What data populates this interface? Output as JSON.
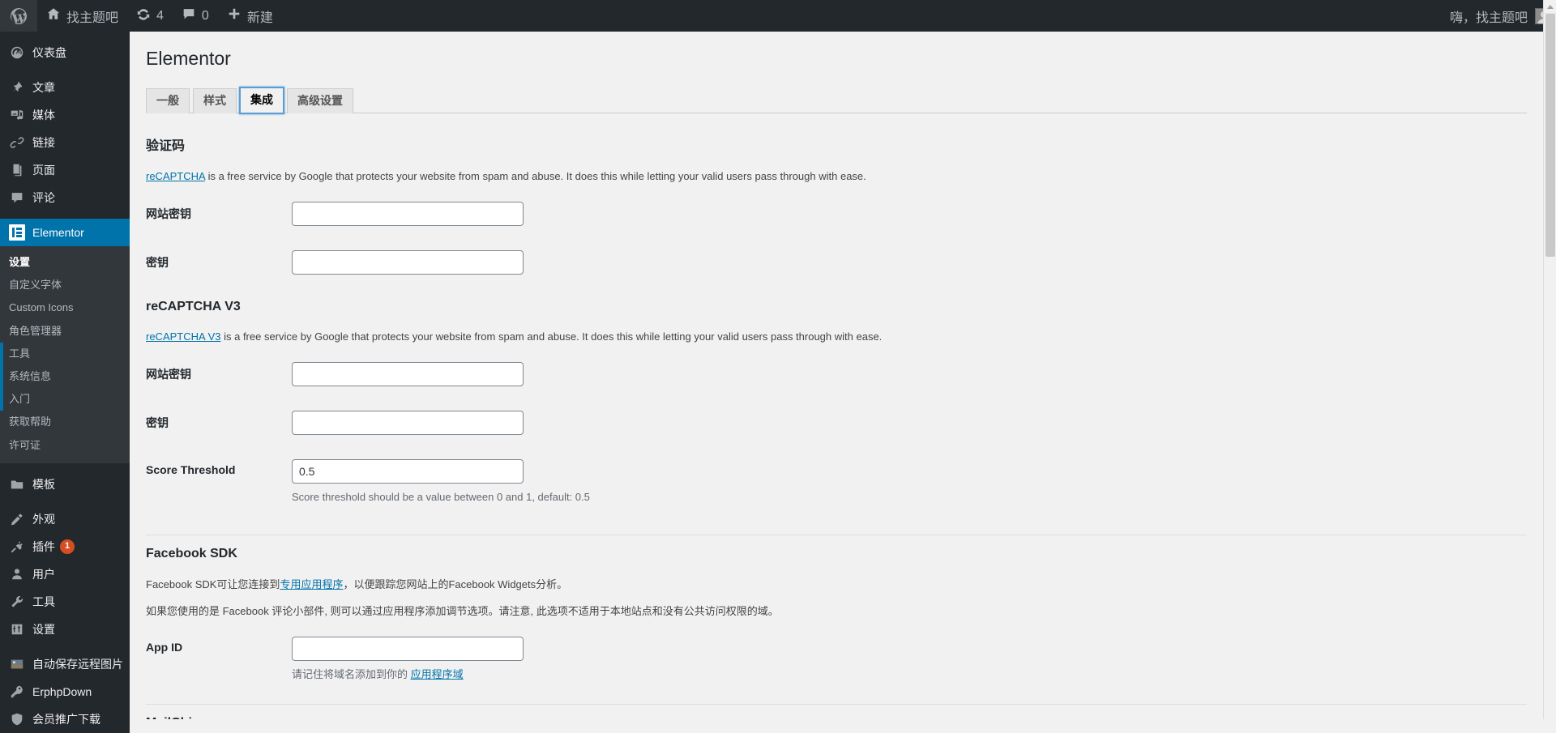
{
  "adminbar": {
    "logo_icon": "wordpress-logo-icon",
    "site_icon": "home-icon",
    "site_name": "找主题吧",
    "updates_icon": "updates-icon",
    "updates_count": "4",
    "comments_icon": "comment-bubble-icon",
    "comments_count": "0",
    "new_icon": "plus-icon",
    "new_label": "新建",
    "howdy": "嗨，找主题吧",
    "avatar": "user-avatar"
  },
  "sidebar": {
    "items": [
      {
        "label": "仪表盘",
        "icon": "dashboard-icon",
        "name": "dashboard"
      },
      {
        "label": "文章",
        "icon": "pin-icon",
        "name": "posts"
      },
      {
        "label": "媒体",
        "icon": "media-icon",
        "name": "media"
      },
      {
        "label": "链接",
        "icon": "link-icon",
        "name": "links"
      },
      {
        "label": "页面",
        "icon": "page-icon",
        "name": "pages"
      },
      {
        "label": "评论",
        "icon": "comment-icon",
        "name": "comments"
      },
      {
        "label": "Elementor",
        "icon": "elementor-icon",
        "name": "elementor",
        "current": true
      },
      {
        "label": "模板",
        "icon": "folder-icon",
        "name": "templates"
      },
      {
        "label": "外观",
        "icon": "appearance-icon",
        "name": "appearance"
      },
      {
        "label": "插件",
        "icon": "plugins-icon",
        "name": "plugins",
        "badge": "1"
      },
      {
        "label": "用户",
        "icon": "users-icon",
        "name": "users"
      },
      {
        "label": "工具",
        "icon": "tools-icon",
        "name": "tools"
      },
      {
        "label": "设置",
        "icon": "settings-icon",
        "name": "settings"
      },
      {
        "label": "自动保存远程图片",
        "icon": "image-icon",
        "name": "auto-save-remote-images"
      },
      {
        "label": "ErphpDown",
        "icon": "key-icon",
        "name": "erphpdown"
      },
      {
        "label": "会员推广下载",
        "icon": "shield-icon",
        "name": "member-promo-download"
      }
    ],
    "submenu": [
      {
        "label": "设置",
        "current": true
      },
      {
        "label": "自定义字体"
      },
      {
        "label": "Custom Icons"
      },
      {
        "label": "角色管理器"
      },
      {
        "label": "工具",
        "highlight": true
      },
      {
        "label": "系统信息",
        "highlight": true
      },
      {
        "label": "入门",
        "highlight": true
      },
      {
        "label": "获取帮助"
      },
      {
        "label": "许可证"
      }
    ]
  },
  "page": {
    "title": "Elementor",
    "tabs": [
      {
        "label": "一般",
        "active": false
      },
      {
        "label": "样式",
        "active": false
      },
      {
        "label": "集成",
        "active": true
      },
      {
        "label": "高级设置",
        "active": false
      }
    ]
  },
  "sections": {
    "recaptcha": {
      "title": "验证码",
      "desc_link": "reCAPTCHA",
      "desc_rest": " is a free service by Google that protects your website from spam and abuse. It does this while letting your valid users pass through with ease.",
      "fields": [
        {
          "label": "网站密钥",
          "value": "",
          "placeholder": "",
          "name": "recaptcha-site-key"
        },
        {
          "label": "密钥",
          "value": "",
          "placeholder": "",
          "name": "recaptcha-secret-key"
        }
      ]
    },
    "recaptcha_v3": {
      "title": "reCAPTCHA V3",
      "desc_link": "reCAPTCHA V3",
      "desc_rest": " is a free service by Google that protects your website from spam and abuse. It does this while letting your valid users pass through with ease.",
      "fields": [
        {
          "label": "网站密钥",
          "value": "",
          "placeholder": "",
          "name": "recaptcha-v3-site-key"
        },
        {
          "label": "密钥",
          "value": "",
          "placeholder": "",
          "name": "recaptcha-v3-secret-key"
        }
      ],
      "threshold_label": "Score Threshold",
      "threshold_value": "0.5",
      "threshold_desc": "Score threshold should be a value between 0 and 1, default: 0.5"
    },
    "facebook_sdk": {
      "title": "Facebook SDK",
      "desc1_pre": "Facebook SDK可让您连接到",
      "desc1_link": "专用应用程序",
      "desc1_post": "，以便跟踪您网站上的Facebook Widgets分析。",
      "desc2": "如果您使用的是 Facebook 评论小部件, 则可以通过应用程序添加调节选项。请注意, 此选项不适用于本地站点和没有公共访问权限的域。",
      "app_id_label": "App ID",
      "app_id_value": "",
      "app_id_desc_pre": "请记住将域名添加到你的 ",
      "app_id_desc_link": "应用程序域"
    },
    "mailchimp": {
      "title": "MailChimp"
    }
  }
}
